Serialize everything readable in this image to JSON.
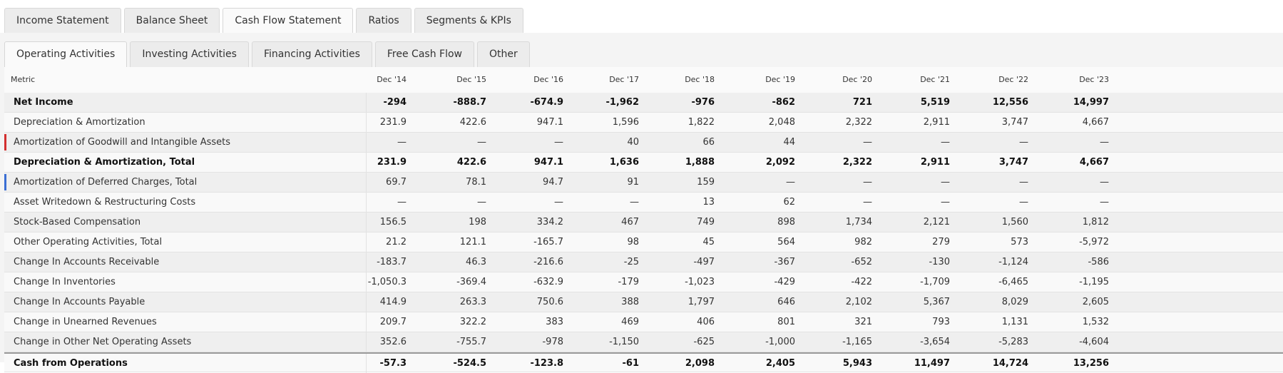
{
  "tabs": [
    "Income Statement",
    "Balance Sheet",
    "Cash Flow Statement",
    "Ratios",
    "Segments & KPIs"
  ],
  "active_tab": 2,
  "subtabs": [
    "Operating Activities",
    "Investing Activities",
    "Financing Activities",
    "Free Cash Flow",
    "Other"
  ],
  "active_subtab": 0,
  "table": {
    "metric_header": "Metric",
    "years": [
      "Dec '14",
      "Dec '15",
      "Dec '16",
      "Dec '17",
      "Dec '18",
      "Dec '19",
      "Dec '20",
      "Dec '21",
      "Dec '22",
      "Dec '23"
    ],
    "rows": [
      {
        "name": "Net Income",
        "bold": true,
        "values": [
          "-294",
          "-888.7",
          "-674.9",
          "-1,962",
          "-976",
          "-862",
          "721",
          "5,519",
          "12,556",
          "14,997"
        ]
      },
      {
        "name": "Depreciation & Amortization",
        "values": [
          "231.9",
          "422.6",
          "947.1",
          "1,596",
          "1,822",
          "2,048",
          "2,322",
          "2,911",
          "3,747",
          "4,667"
        ]
      },
      {
        "name": "Amortization of Goodwill and Intangible Assets",
        "marker": "#d32f2f",
        "values": [
          "—",
          "—",
          "—",
          "40",
          "66",
          "44",
          "—",
          "—",
          "—",
          "—"
        ]
      },
      {
        "name": "Depreciation & Amortization, Total",
        "bold": true,
        "values": [
          "231.9",
          "422.6",
          "947.1",
          "1,636",
          "1,888",
          "2,092",
          "2,322",
          "2,911",
          "3,747",
          "4,667"
        ]
      },
      {
        "name": "Amortization of Deferred Charges, Total",
        "marker": "#3b6fd4",
        "values": [
          "69.7",
          "78.1",
          "94.7",
          "91",
          "159",
          "—",
          "—",
          "—",
          "—",
          "—"
        ]
      },
      {
        "name": "Asset Writedown & Restructuring Costs",
        "values": [
          "—",
          "—",
          "—",
          "—",
          "13",
          "62",
          "—",
          "—",
          "—",
          "—"
        ]
      },
      {
        "name": "Stock-Based Compensation",
        "values": [
          "156.5",
          "198",
          "334.2",
          "467",
          "749",
          "898",
          "1,734",
          "2,121",
          "1,560",
          "1,812"
        ]
      },
      {
        "name": "Other Operating Activities, Total",
        "values": [
          "21.2",
          "121.1",
          "-165.7",
          "98",
          "45",
          "564",
          "982",
          "279",
          "573",
          "-5,972"
        ]
      },
      {
        "name": "Change In Accounts Receivable",
        "values": [
          "-183.7",
          "46.3",
          "-216.6",
          "-25",
          "-497",
          "-367",
          "-652",
          "-130",
          "-1,124",
          "-586"
        ]
      },
      {
        "name": "Change In Inventories",
        "values": [
          "-1,050.3",
          "-369.4",
          "-632.9",
          "-179",
          "-1,023",
          "-429",
          "-422",
          "-1,709",
          "-6,465",
          "-1,195"
        ]
      },
      {
        "name": "Change In Accounts Payable",
        "values": [
          "414.9",
          "263.3",
          "750.6",
          "388",
          "1,797",
          "646",
          "2,102",
          "5,367",
          "8,029",
          "2,605"
        ]
      },
      {
        "name": "Change in Unearned Revenues",
        "values": [
          "209.7",
          "322.2",
          "383",
          "469",
          "406",
          "801",
          "321",
          "793",
          "1,131",
          "1,532"
        ]
      },
      {
        "name": "Change in Other Net Operating Assets",
        "values": [
          "352.6",
          "-755.7",
          "-978",
          "-1,150",
          "-625",
          "-1,000",
          "-1,165",
          "-3,654",
          "-5,283",
          "-4,604"
        ]
      },
      {
        "name": "Cash from Operations",
        "bold": true,
        "total": true,
        "values": [
          "-57.3",
          "-524.5",
          "-123.8",
          "-61",
          "2,098",
          "2,405",
          "5,943",
          "11,497",
          "14,724",
          "13,256"
        ]
      }
    ]
  }
}
